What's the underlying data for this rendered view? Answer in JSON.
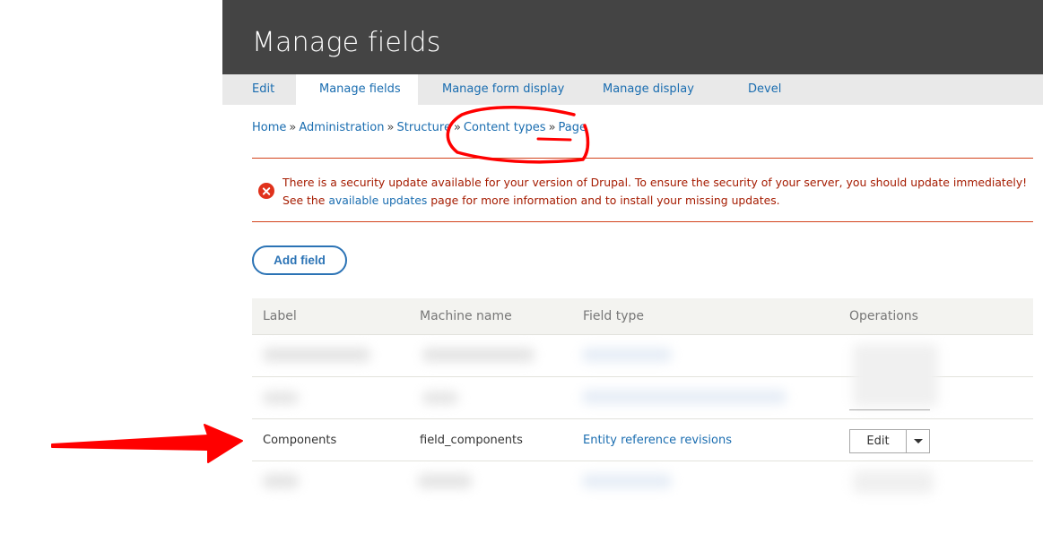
{
  "header": {
    "title": "Manage fields"
  },
  "tabs": [
    {
      "label": "Edit",
      "active": false
    },
    {
      "label": "Manage fields",
      "active": true
    },
    {
      "label": "Manage form display",
      "active": false
    },
    {
      "label": "Manage display",
      "active": false
    },
    {
      "label": "Devel",
      "active": false
    }
  ],
  "breadcrumb": {
    "separator": "»",
    "items": [
      "Home",
      "Administration",
      "Structure",
      "Content types",
      "Page"
    ]
  },
  "alert": {
    "type": "error",
    "icon": "error-circle-x-icon",
    "line1": "There is a security update available for your version of Drupal. To ensure the security of your server, you should update immediately!",
    "line2_prefix": "See the ",
    "line2_link": "available updates",
    "line2_suffix": " page for more information and to install your missing updates."
  },
  "add_field_button": "Add field",
  "table": {
    "columns": [
      "Label",
      "Machine name",
      "Field type",
      "Operations"
    ],
    "rows": [
      {
        "label": "",
        "machine_name": "",
        "field_type": "",
        "operation": "",
        "blurred": true
      },
      {
        "label": "",
        "machine_name": "",
        "field_type": "",
        "operation": "",
        "blurred": true
      },
      {
        "label": "Components",
        "machine_name": "field_components",
        "field_type": "Entity reference revisions",
        "operation": "Edit",
        "blurred": false
      },
      {
        "label": "",
        "machine_name": "",
        "field_type": "",
        "operation": "",
        "blurred": true
      }
    ]
  },
  "annotations": {
    "color": "#ff0000",
    "items": [
      "red-arrow-pointing-to-components-row",
      "red-circle-around-content-types-page-breadcrumb"
    ]
  }
}
